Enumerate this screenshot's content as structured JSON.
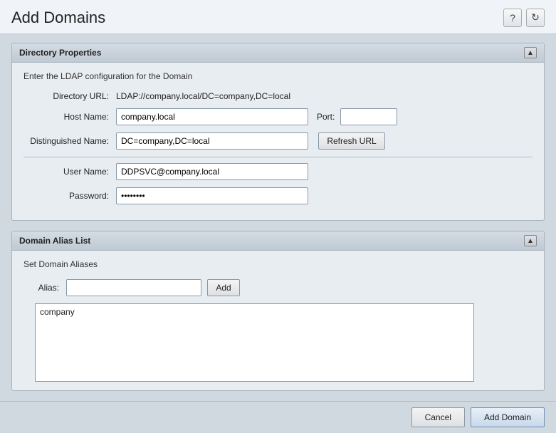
{
  "header": {
    "title": "Add Domains",
    "help_icon": "?",
    "refresh_icon": "↻"
  },
  "directory_properties": {
    "panel_title": "Directory Properties",
    "subtitle": "Enter the LDAP configuration for the Domain",
    "directory_url_label": "Directory URL:",
    "directory_url_value": "LDAP://company.local/DC=company,DC=local",
    "hostname_label": "Host Name:",
    "hostname_value": "company.local",
    "port_label": "Port:",
    "port_value": "",
    "dn_label": "Distinguished Name:",
    "dn_value": "DC=company,DC=local",
    "refresh_url_label": "Refresh URL",
    "username_label": "User Name:",
    "username_value": "DDPSVC@company.local",
    "password_label": "Password:",
    "password_value": "••••••••"
  },
  "domain_alias": {
    "panel_title": "Domain Alias List",
    "subtitle": "Set Domain Aliases",
    "alias_label": "Alias:",
    "alias_placeholder": "",
    "add_button_label": "Add",
    "alias_list_items": [
      "company"
    ]
  },
  "footer": {
    "cancel_label": "Cancel",
    "add_domain_label": "Add Domain"
  }
}
